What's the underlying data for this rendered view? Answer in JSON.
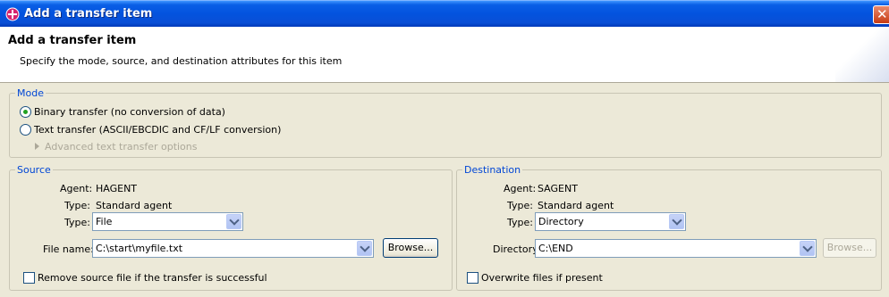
{
  "window": {
    "title": "Add a transfer item",
    "close_glyph": "✕"
  },
  "header": {
    "title": "Add a transfer item",
    "description": "Specify the mode, source, and destination attributes for this item"
  },
  "mode": {
    "legend": "Mode",
    "binary_label": "Binary transfer (no conversion of data)",
    "text_label": "Text transfer (ASCII/EBCDIC and CF/LF conversion)",
    "advanced_label": "Advanced text transfer options",
    "selected": "binary"
  },
  "source": {
    "legend": "Source",
    "agent_label": "Agent:",
    "agent_value": "HAGENT",
    "type_label": "Type:",
    "type_value": "Standard agent",
    "kind_label": "Type:",
    "kind_value": "File",
    "path_label": "File name:",
    "path_value": "C:\\start\\myfile.txt",
    "browse_label": "Browse...",
    "remove_label": "Remove source file if the transfer is successful"
  },
  "destination": {
    "legend": "Destination",
    "agent_label": "Agent:",
    "agent_value": "SAGENT",
    "type_label": "Type:",
    "type_value": "Standard agent",
    "kind_label": "Type:",
    "kind_value": "Directory",
    "path_label": "Directory:",
    "path_value": "C:\\END",
    "browse_label": "Browse...",
    "overwrite_label": "Overwrite files if present"
  },
  "colors": {
    "legend": "#0046d5",
    "title_bar": "#0353de",
    "radio_dot": "#21a121"
  }
}
